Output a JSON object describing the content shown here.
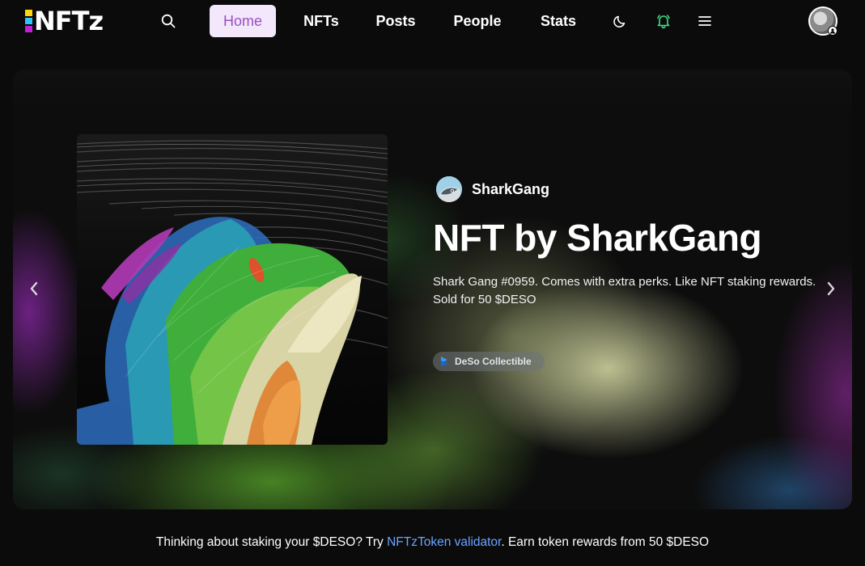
{
  "brand": {
    "logo_text": "NFTz",
    "logo_colors": [
      "#ffd60a",
      "#2ec4ff",
      "#c41fd6",
      "#ff2d7a"
    ]
  },
  "nav": {
    "search_icon": "search-icon",
    "links": [
      {
        "label": "Home",
        "active": true
      },
      {
        "label": "NFTs",
        "active": false
      },
      {
        "label": "Posts",
        "active": false
      },
      {
        "label": "People",
        "active": false
      },
      {
        "label": "Stats",
        "active": false
      }
    ],
    "theme_icon": "moon-icon",
    "notification_icon": "bell-icon",
    "notification_color": "#3ddc84",
    "menu_icon": "hamburger-menu-icon",
    "avatar_icon": "user-avatar"
  },
  "hero": {
    "creator": {
      "name": "SharkGang",
      "avatar_icon": "creator-avatar"
    },
    "title": "NFT by SharkGang",
    "description": "Shark Gang #0959. Comes with extra perks. Like NFT staking rewards.",
    "sold_text": "Sold for 50 $DESO",
    "badge": {
      "label": "DeSo Collectible",
      "icon": "deso-logo-icon"
    },
    "prev_icon": "chevron-left-icon",
    "next_icon": "chevron-right-icon"
  },
  "footer_note": {
    "before": "Thinking about staking your $DESO? Try ",
    "link": "NFTzToken validator",
    "after": ". Earn token rewards from 50 $DESO",
    "link_color": "#6aa5ff"
  }
}
